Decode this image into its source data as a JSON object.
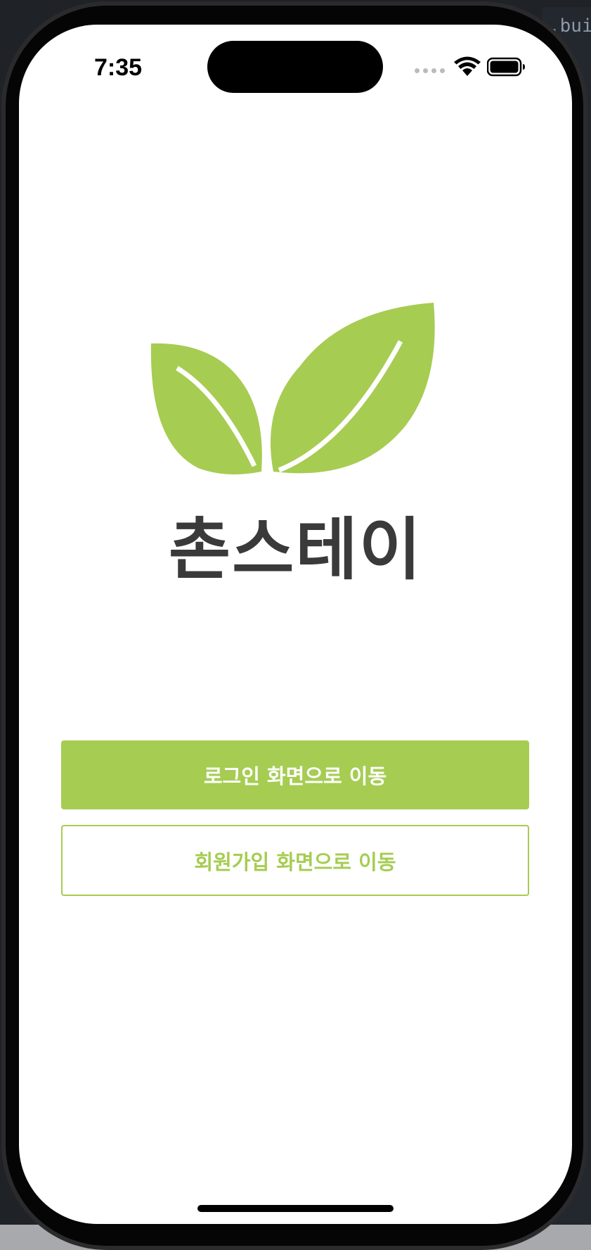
{
  "status_bar": {
    "time": "7:35"
  },
  "editor": {
    "fragment": ".bui"
  },
  "logo": {
    "name": "촌스테이",
    "icon": "leaves-icon",
    "leaf_color": "#a6cc52",
    "text_color": "#3a3a3a"
  },
  "actions": {
    "login_label": "로그인 화면으로 이동",
    "signup_label": "회원가입 화면으로 이동"
  },
  "colors": {
    "accent": "#a6cc52",
    "background": "#ffffff"
  }
}
